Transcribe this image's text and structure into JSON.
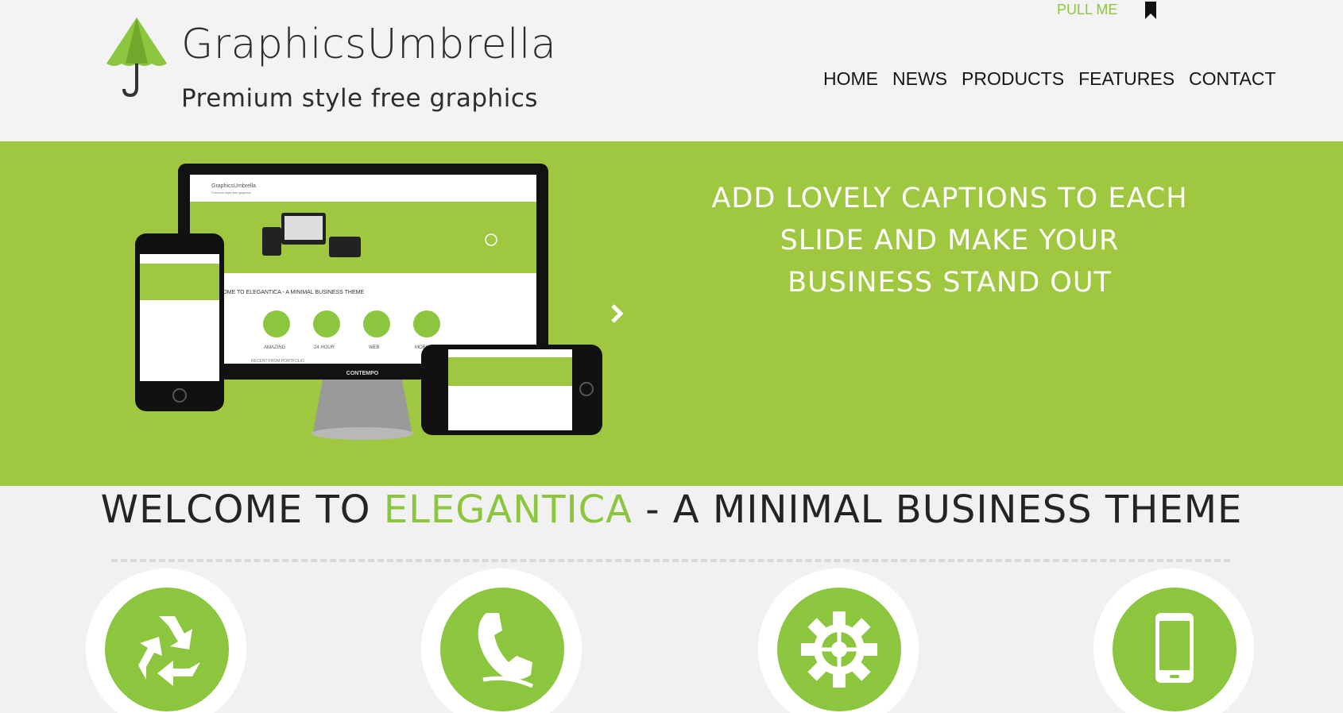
{
  "header": {
    "brand_title": "GraphicsUmbrella",
    "brand_tagline": "Premium style free graphics",
    "pull_me": "PULL ME",
    "nav": [
      "HOME",
      "NEWS",
      "PRODUCTS",
      "FEATURES",
      "CONTACT"
    ]
  },
  "slider": {
    "caption": "ADD LOVELY CAPTIONS TO EACH SLIDE AND MAKE YOUR BUSINESS STAND OUT",
    "screen_text": {
      "brand": "GraphicsUmbrella",
      "tagline": "Premium style free graphics",
      "welcome": "WELCOME TO ELEGANTICA - A MINIMAL BUSINESS THEME",
      "features": [
        "AMAZING",
        "24 HOUR",
        "WEB",
        "MOBILE"
      ],
      "recent": "RECENT FROM PORTFOLIO",
      "monitor_label": "CONTEMPO"
    }
  },
  "welcome": {
    "prefix": "WELCOME TO ",
    "accent": "ELEGANTICA",
    "suffix": "  - A MINIMAL BUSINESS THEME"
  },
  "features": [
    {
      "icon": "recycle-icon"
    },
    {
      "icon": "phone-icon"
    },
    {
      "icon": "gear-icon"
    },
    {
      "icon": "mobile-icon"
    }
  ],
  "colors": {
    "accent": "#8cc63f",
    "slider_bg": "#9fc73f",
    "page_bg": "#f1f1f1",
    "text_dark": "#242424"
  }
}
